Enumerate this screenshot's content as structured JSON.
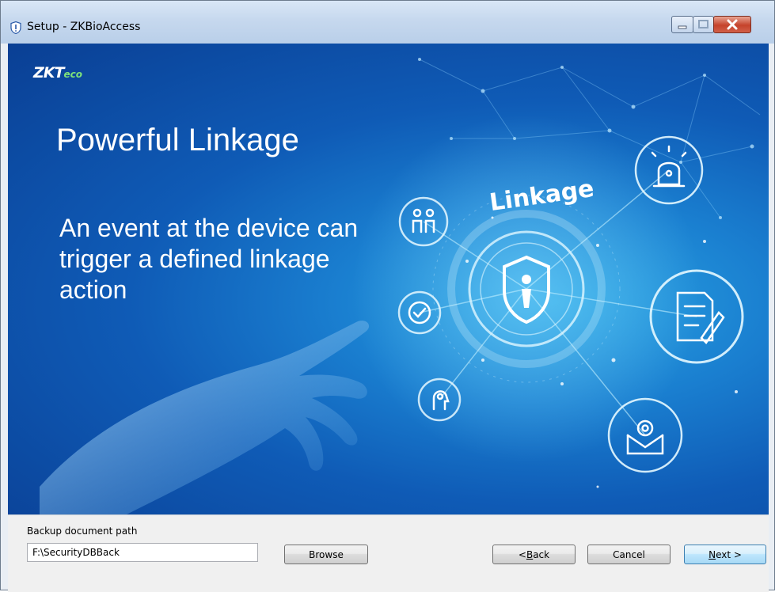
{
  "window": {
    "title": "Setup - ZKBioAccess",
    "title_icon": "shield-icon",
    "controls": [
      "minimize",
      "maximize",
      "close"
    ]
  },
  "banner": {
    "logo_main": "ZKT",
    "logo_suffix": "eco",
    "headline": "Powerful Linkage",
    "description": "An event at the device can trigger a defined linkage action",
    "graphic_label": "Linkage",
    "icons": [
      "people-icon",
      "verified-icon",
      "head-icon",
      "shield-user-icon",
      "alarm-light-icon",
      "document-edit-icon",
      "email-icon"
    ]
  },
  "footer": {
    "path_label": "Backup document path",
    "path_value": "F:\\SecurityDBBack",
    "browse_label": "Browse",
    "back_prefix": "< ",
    "back_mnemonic": "B",
    "back_rest": "ack",
    "cancel_label": "Cancel",
    "next_mnemonic": "N",
    "next_rest": "ext >"
  },
  "colors": {
    "banner_dark": "#0a3f94",
    "banner_light": "#2aa5e3",
    "logo_accent": "#7ee27a",
    "close_button": "#c5432b"
  }
}
